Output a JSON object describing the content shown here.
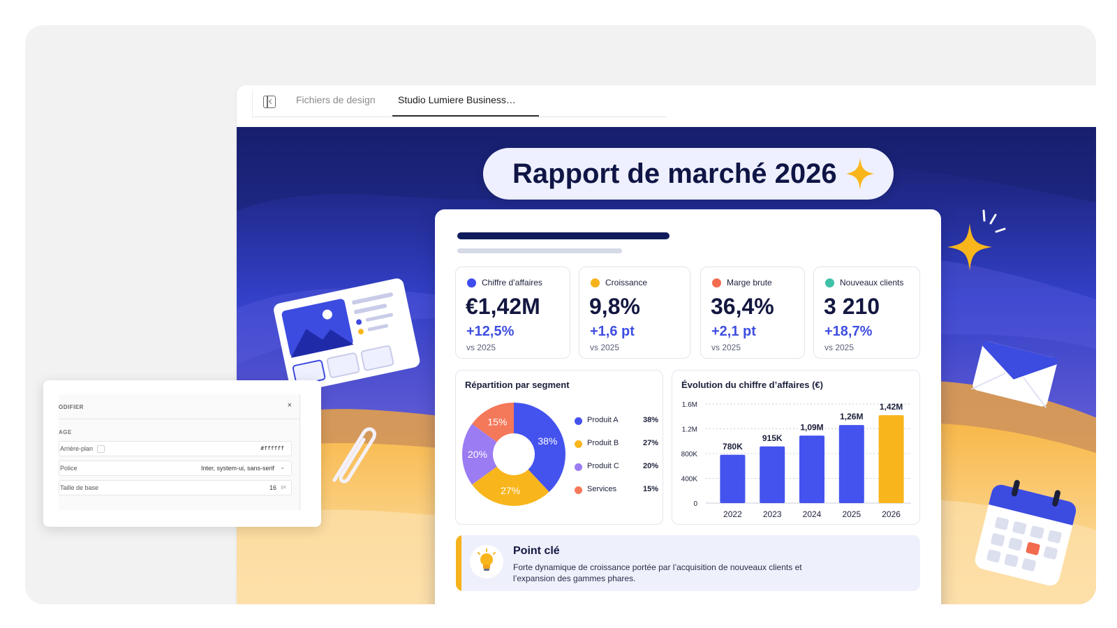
{
  "tabs": {
    "sidebar_toggle": "sidebar-toggle-icon",
    "items": [
      "Fichiers de design",
      "Studio Lumiere Business…"
    ],
    "active_index": 1
  },
  "slide": {
    "title": "Rapport de marché 2026",
    "kpis": [
      {
        "label": "Chiffre d’affaires",
        "value": "€1,42M",
        "change": "+12,5%",
        "compare": "vs 2025",
        "color": "#3f4df0"
      },
      {
        "label": "Croissance",
        "value": "9,8%",
        "change": "+1,6 pt",
        "compare": "vs 2025",
        "color": "#f6b21b"
      },
      {
        "label": "Marge brute",
        "value": "36,4%",
        "change": "+2,1 pt",
        "compare": "vs 2025",
        "color": "#f26b4f"
      },
      {
        "label": "Nouveaux clients",
        "value": "3 210",
        "change": "+18,7%",
        "compare": "vs 2025",
        "color": "#3fc1a8"
      }
    ],
    "pie_title": "Répartition par segment",
    "bar_title": "Évolution du chiffre d’affaires (€)",
    "key_point": {
      "title": "Point clé",
      "text": "Forte dynamique de croissance portée par l’acquisition de nouveaux clients et l’expansion des gammes phares."
    }
  },
  "chart_data": [
    {
      "type": "pie",
      "title": "Répartition par segment",
      "categories": [
        "Produit A",
        "Produit B",
        "Produit C",
        "Services"
      ],
      "values": [
        38,
        27,
        20,
        15
      ],
      "value_labels": [
        "38%",
        "27%",
        "20%",
        "15%"
      ],
      "colors": [
        "#4453ee",
        "#f8b61c",
        "#9b7cf2",
        "#f4785a"
      ],
      "legend": "right"
    },
    {
      "type": "bar",
      "title": "Évolution du chiffre d’affaires (€)",
      "categories": [
        "2022",
        "2023",
        "2024",
        "2025",
        "2026"
      ],
      "values": [
        780000,
        915000,
        1090000,
        1260000,
        1420000
      ],
      "value_labels": [
        "780K",
        "915K",
        "1,09M",
        "1,26M",
        "1,42M"
      ],
      "yticks": [
        0,
        400000,
        800000,
        1200000,
        1600000
      ],
      "ytick_labels": [
        "0",
        "400K",
        "800K",
        "1.2M",
        "1.6M"
      ],
      "ylim": [
        0,
        1600000
      ],
      "colors": [
        "#4453ee",
        "#4453ee",
        "#4453ee",
        "#4453ee",
        "#f8b61c"
      ],
      "grid": true
    }
  ],
  "modifier_panel": {
    "header": "ODIFIER",
    "close": "×",
    "section": "AGE",
    "rows": [
      {
        "label": "Arrière-plan",
        "value": "#ffffff"
      },
      {
        "label": "Police",
        "value": "Inter, system-ui, sans-serif"
      },
      {
        "label": "Taille de base",
        "value": "16",
        "unit": "px"
      }
    ]
  }
}
